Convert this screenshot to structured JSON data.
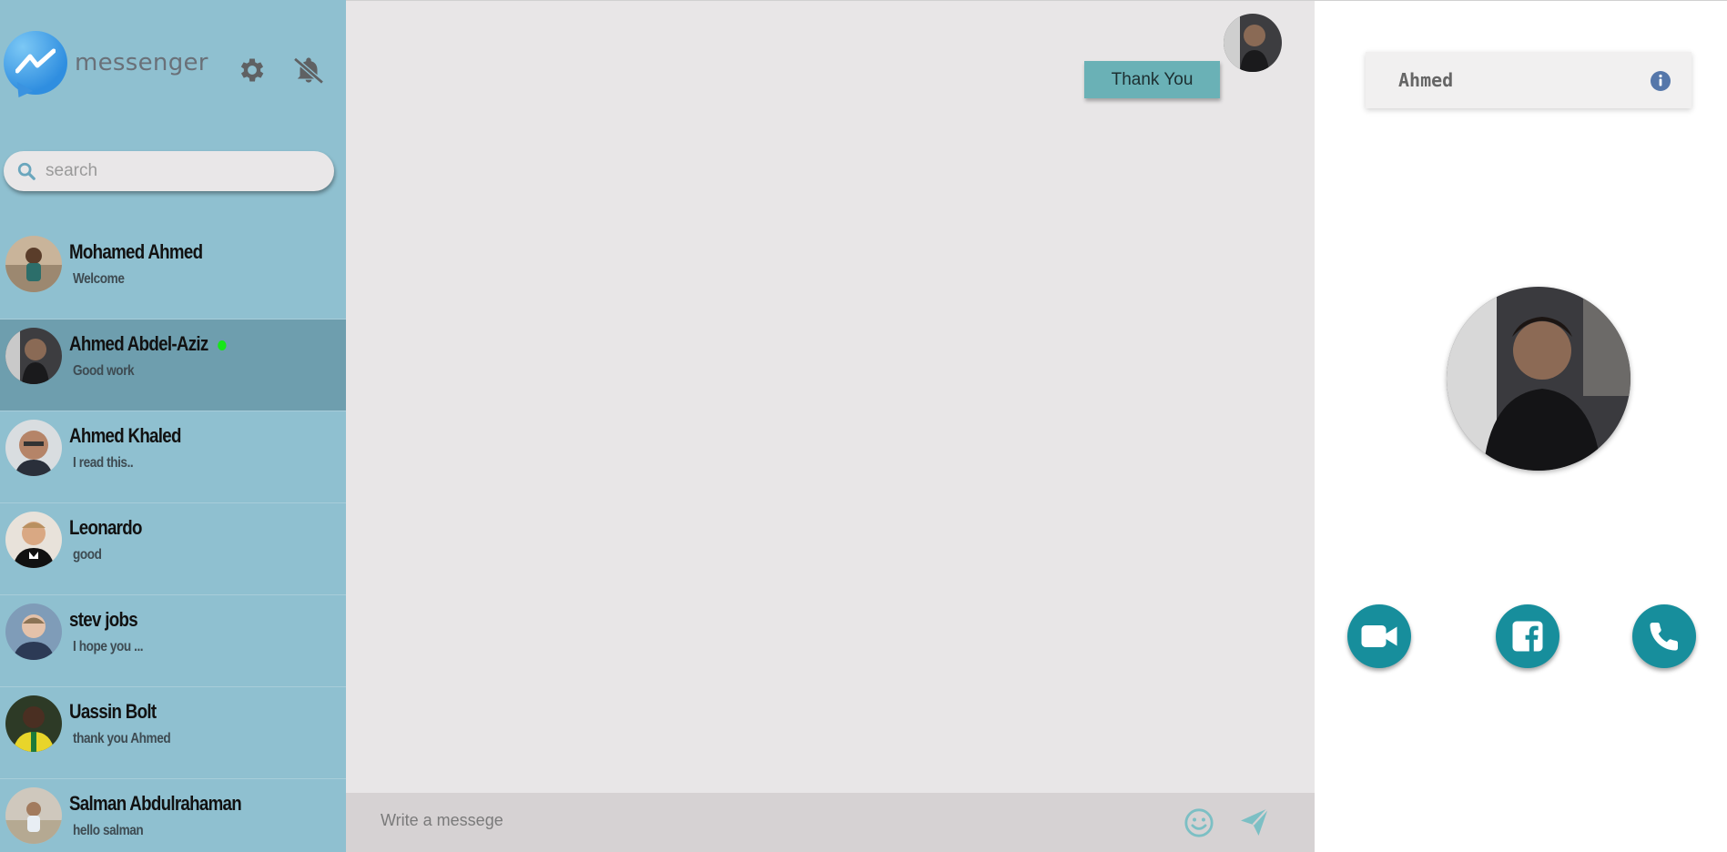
{
  "sidebar": {
    "brand": "messenger",
    "search_placeholder": "search",
    "contacts": [
      {
        "name": "Mohamed Ahmed",
        "message": "Welcome",
        "active": false,
        "online": false
      },
      {
        "name": "Ahmed Abdel-Aziz",
        "message": "Good work",
        "active": true,
        "online": true
      },
      {
        "name": "Ahmed Khaled",
        "message": "I read this..",
        "active": false,
        "online": false
      },
      {
        "name": "Leonardo",
        "message": "good",
        "active": false,
        "online": false
      },
      {
        "name": "stev jobs",
        "message": "I hope you ...",
        "active": false,
        "online": false
      },
      {
        "name": "Uassin Bolt",
        "message": "thank you Ahmed",
        "active": false,
        "online": false
      },
      {
        "name": "Salman Abdulrahaman",
        "message": "hello salman",
        "active": false,
        "online": false
      }
    ]
  },
  "chat": {
    "messages": [
      {
        "text": "Thank You"
      }
    ],
    "composer_placeholder": "Write a messege"
  },
  "info": {
    "title": "Ahmed"
  },
  "colors": {
    "sidebar": "#8fc0d0",
    "sidebar_active": "#6e9eae",
    "chat_bg": "#e8e6e7",
    "bubble": "#6ab1b6",
    "action": "#178e9c",
    "online": "#17e617"
  }
}
